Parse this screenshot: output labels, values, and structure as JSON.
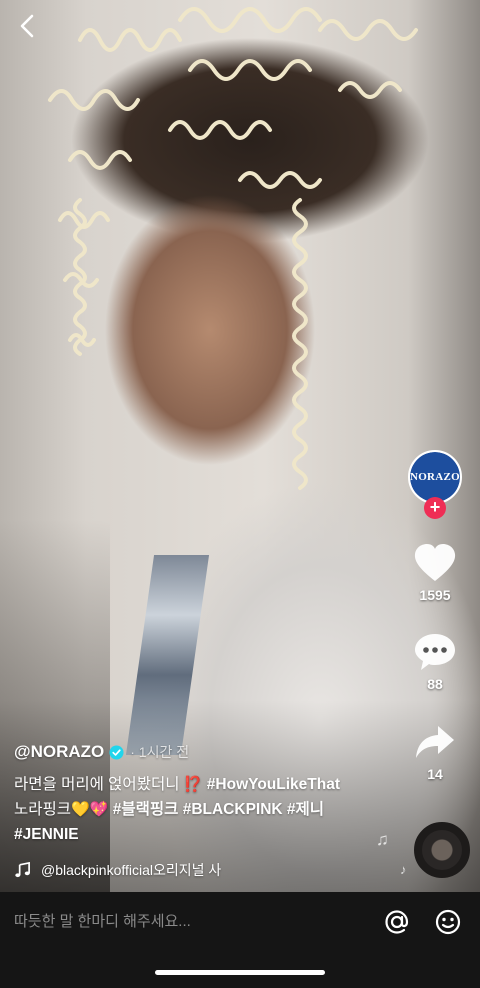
{
  "video": {
    "nav": {
      "back_icon": "chevron-left-icon"
    }
  },
  "profile": {
    "logo_text": "NORAZO",
    "follow_icon": "plus-icon",
    "follow_symbol": "+"
  },
  "actions": {
    "like": {
      "icon": "heart-icon",
      "count": "1595"
    },
    "comment": {
      "icon": "comment-bubble-icon",
      "count": "88"
    },
    "share": {
      "icon": "share-arrow-icon",
      "count": "14"
    }
  },
  "post": {
    "username": "@NORAZO",
    "verified_icon": "verified-check-icon",
    "time": "· 1시간 전",
    "line1_text": "라면을 머리에 얹어봤더니",
    "line1_emoji": "⁉️",
    "line1_tag": "#HowYouLikeThat",
    "line2_text": "노라핑크",
    "line2_emoji": "💛💖",
    "line2_tag1": "#블랙핑크",
    "line2_tag2": "#BLACKPINK",
    "line2_tag3": "#제니",
    "line3_tag": "#JENNIE",
    "sound_icon": "music-note-icon",
    "sound_text": "@blackpinkofficial오리지널 사"
  },
  "comment_bar": {
    "placeholder": "따듯한 말 한마디 해주세요...",
    "mention_icon": "at-icon",
    "emoji_icon": "smiley-icon"
  },
  "colors": {
    "accent": "#ef2d55",
    "bar_bg": "#151515",
    "profile_logo_bg": "#1d4e9e",
    "verified": "#20d5ec"
  }
}
